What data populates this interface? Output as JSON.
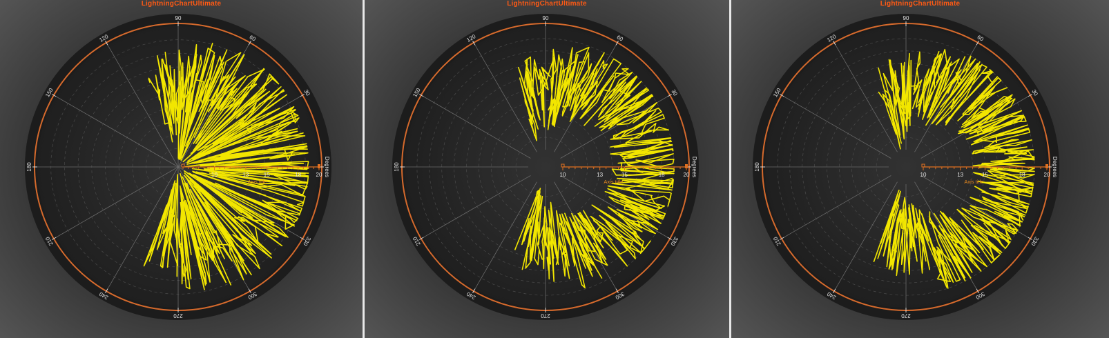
{
  "charts": [
    {
      "title": "LightningChartUltimate",
      "inner_radius_value": 7,
      "show_inner_spokes": true
    },
    {
      "title": "LightningChartUltimate",
      "inner_radius_value": 10,
      "show_inner_spokes": false
    },
    {
      "title": "LightningChartUltimate",
      "inner_radius_value": 10,
      "show_inner_spokes": false
    }
  ],
  "chart_data": [
    {
      "type": "polar",
      "title": "LightningChartUltimate",
      "angle_ticks": [
        "0",
        "30",
        "60",
        "90",
        "120",
        "150",
        "180",
        "210",
        "240",
        "270",
        "300",
        "330"
      ],
      "amplitude_ticks": [
        "10",
        "13",
        "15",
        "18",
        "20"
      ],
      "amplitude_range": [
        7,
        20
      ],
      "amplitude_axis_unit": "Degrees",
      "amplitude_axis_title": "Axis title",
      "grid": true,
      "series_color": "#f2e600",
      "series": [
        {
          "values_description": "noisy amplitude vs angle, concentrated between angles -110 and 110 degrees, amplitudes roughly 7-18"
        }
      ]
    },
    {
      "type": "polar",
      "title": "LightningChartUltimate",
      "angle_ticks": [
        "0",
        "30",
        "60",
        "90",
        "120",
        "150",
        "180",
        "210",
        "240",
        "270",
        "300",
        "330"
      ],
      "amplitude_ticks": [
        "10",
        "13",
        "15",
        "18",
        "20"
      ],
      "amplitude_range": [
        10,
        20
      ],
      "amplitude_axis_unit": "Degrees",
      "amplitude_axis_title": "Axis title",
      "grid": true,
      "series_color": "#f2e600"
    },
    {
      "type": "polar",
      "title": "LightningChartUltimate",
      "angle_ticks": [
        "0",
        "30",
        "60",
        "90",
        "120",
        "150",
        "180",
        "210",
        "240",
        "270",
        "300",
        "330"
      ],
      "amplitude_ticks": [
        "10",
        "13",
        "15",
        "18",
        "20"
      ],
      "amplitude_range": [
        10,
        20
      ],
      "amplitude_axis_unit": "Degrees",
      "amplitude_axis_title": "Axis title",
      "grid": true,
      "series_color": "#f2e600"
    }
  ],
  "colors": {
    "title": "#ff5a14",
    "outer_ring": "#d66a2c",
    "series": "#f2e600",
    "amplitude_axis": "#e07020",
    "axis_title": "#e88a20",
    "plot_bg": "#262626",
    "ring_bg": "#1c1c1c"
  }
}
